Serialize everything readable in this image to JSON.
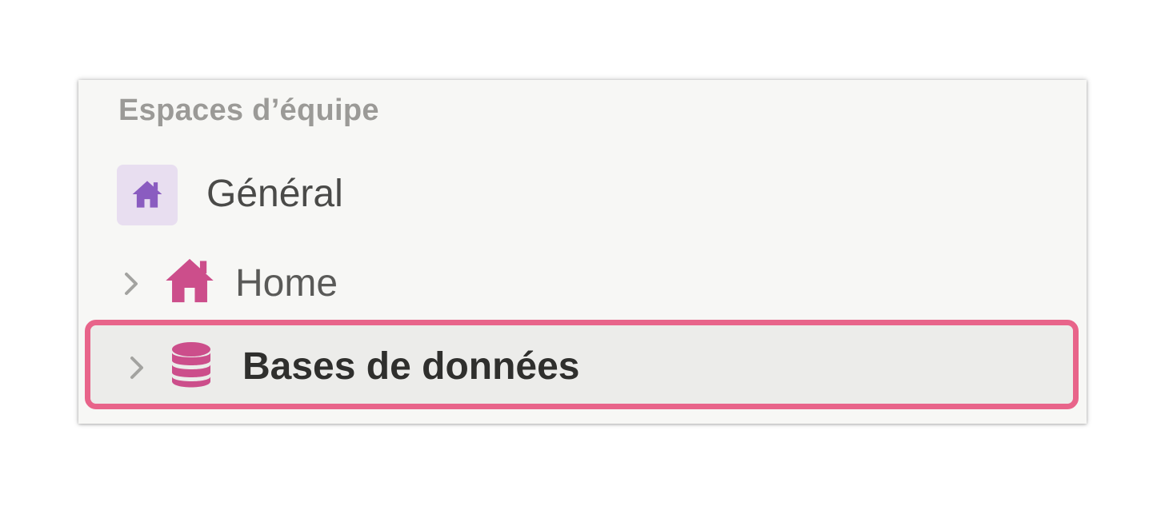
{
  "sidebar": {
    "section_title": "Espaces d’équipe",
    "items": [
      {
        "label": "Général",
        "icon": "home-icon",
        "icon_color": "#8a5cc0",
        "icon_bg": "#e8def0"
      },
      {
        "label": "Home",
        "icon": "home-icon",
        "icon_color": "#cc4e8b",
        "expandable": true
      },
      {
        "label": "Bases de données",
        "icon": "database-icon",
        "icon_color": "#cc4e8b",
        "expandable": true,
        "highlighted": true
      }
    ]
  },
  "colors": {
    "panel_bg": "#f7f7f5",
    "highlight_border": "#e8648a",
    "text_muted": "#9b9a97"
  }
}
